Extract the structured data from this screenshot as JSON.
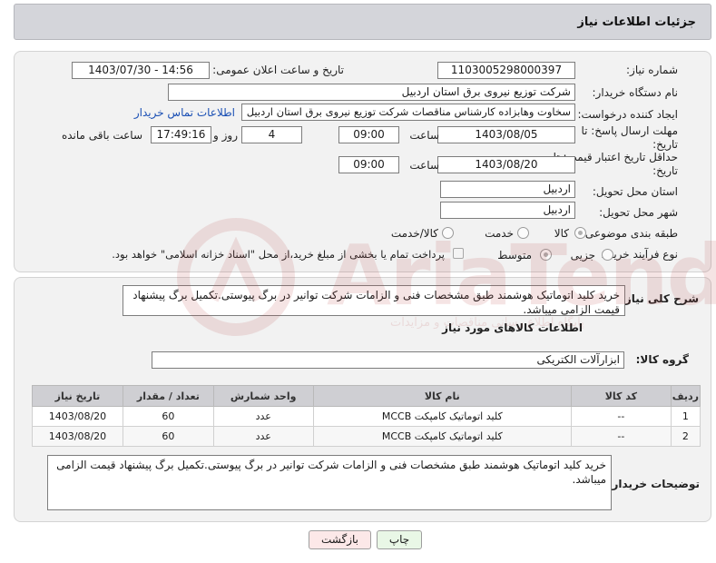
{
  "header": {
    "title": "جزئیات اطلاعات نیاز"
  },
  "form": {
    "need_number_label": "شماره نیاز:",
    "need_number": "1103005298000397",
    "announce_label": "تاریخ و ساعت اعلان عمومی:",
    "announce_value": "1403/07/30 - 14:56",
    "buyer_org_label": "نام دستگاه خریدار:",
    "buyer_org": "شرکت توزیع نیروی برق استان اردبیل",
    "requester_label": "ایجاد کننده درخواست:",
    "requester": "سخاوت وهابزاده کارشناس مناقصات شرکت توزیع نیروی برق استان اردبیل",
    "contact_link": "اطلاعات تماس خریدار",
    "deadline_label_1": "مهلت ارسال پاسخ: تا",
    "deadline_label_2": "تاریخ:",
    "deadline_date": "1403/08/05",
    "time_label": "ساعت",
    "deadline_time": "09:00",
    "days_value": "4",
    "days_label": "روز و",
    "remaining_time": "17:49:16",
    "remaining_label": "ساعت باقی مانده",
    "validity_label_1": "حداقل تاریخ اعتبار قیمت: تا",
    "validity_label_2": "تاریخ:",
    "validity_date": "1403/08/20",
    "validity_time": "09:00",
    "province_label": "استان محل تحویل:",
    "province": "اردبیل",
    "city_label": "شهر محل تحویل:",
    "city": "اردبیل",
    "category_label": "طبقه بندی موضوعی:",
    "category_options": [
      "کالا",
      "خدمت",
      "کالا/خدمت"
    ],
    "process_label": "نوع فرآیند خرید :",
    "process_options": [
      "جزیی",
      "متوسط"
    ],
    "payment_note": "پرداخت تمام یا بخشی از مبلغ خرید،از محل \"اسناد خزانه اسلامی\" خواهد بود."
  },
  "description": {
    "label": "شرح کلی نیاز:",
    "text": "خرید کلید اتوماتیک هوشمند طبق مشخصات فنی و الزامات شرکت توانیر در برگ پیوستی.تکمیل برگ پیشنهاد قیمت الزامی میباشد.",
    "goods_info_title": "اطلاعات کالاهای مورد نیاز",
    "goods_group_label": "گروه کالا:",
    "goods_group": "ابزارآلات الکتریکی"
  },
  "table": {
    "headers": [
      "ردیف",
      "کد کالا",
      "نام کالا",
      "واحد شمارش",
      "تعداد / مقدار",
      "تاریخ نیاز"
    ],
    "rows": [
      [
        "1",
        "--",
        "کلید اتوماتیک کامپکت MCCB",
        "عدد",
        "60",
        "1403/08/20"
      ],
      [
        "2",
        "--",
        "کلید اتوماتیک کامپکت MCCB",
        "عدد",
        "60",
        "1403/08/20"
      ]
    ]
  },
  "buyer_notes": {
    "label": "توضیحات خریدار:",
    "text": "خرید کلید اتوماتیک هوشمند طبق مشخصات فنی و الزامات شرکت توانیر در برگ پیوستی.تکمیل برگ پیشنهاد قیمت الزامی میباشد."
  },
  "buttons": {
    "print": "چاپ",
    "back": "بازگشت"
  },
  "watermark": {
    "text": "AriaTender.net",
    "sub": "پایگاه اطلاع رسانی مناقصات و مزایدات"
  },
  "colors": {
    "header_bg": "#d4d5da",
    "panel_bg": "#f2f2f2",
    "link": "#1a4fb4",
    "back_button_bg": "#fce8e8",
    "print_button_bg": "#e9f7e6"
  }
}
